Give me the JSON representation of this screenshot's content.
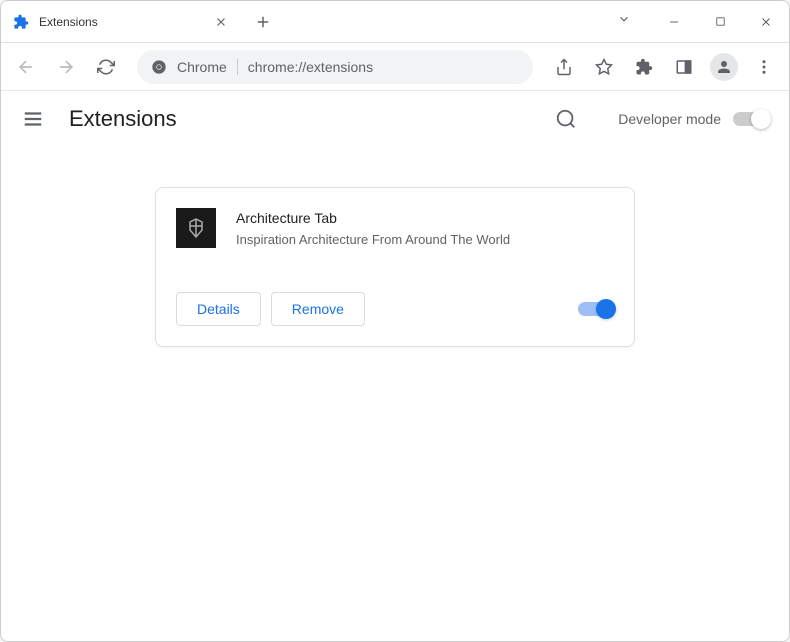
{
  "tab": {
    "title": "Extensions"
  },
  "address": {
    "prefix": "Chrome",
    "url": "chrome://extensions"
  },
  "page": {
    "title": "Extensions",
    "dev_mode_label": "Developer mode"
  },
  "extension": {
    "name": "Architecture Tab",
    "description": "Inspiration Architecture From Around The World",
    "details_label": "Details",
    "remove_label": "Remove"
  }
}
